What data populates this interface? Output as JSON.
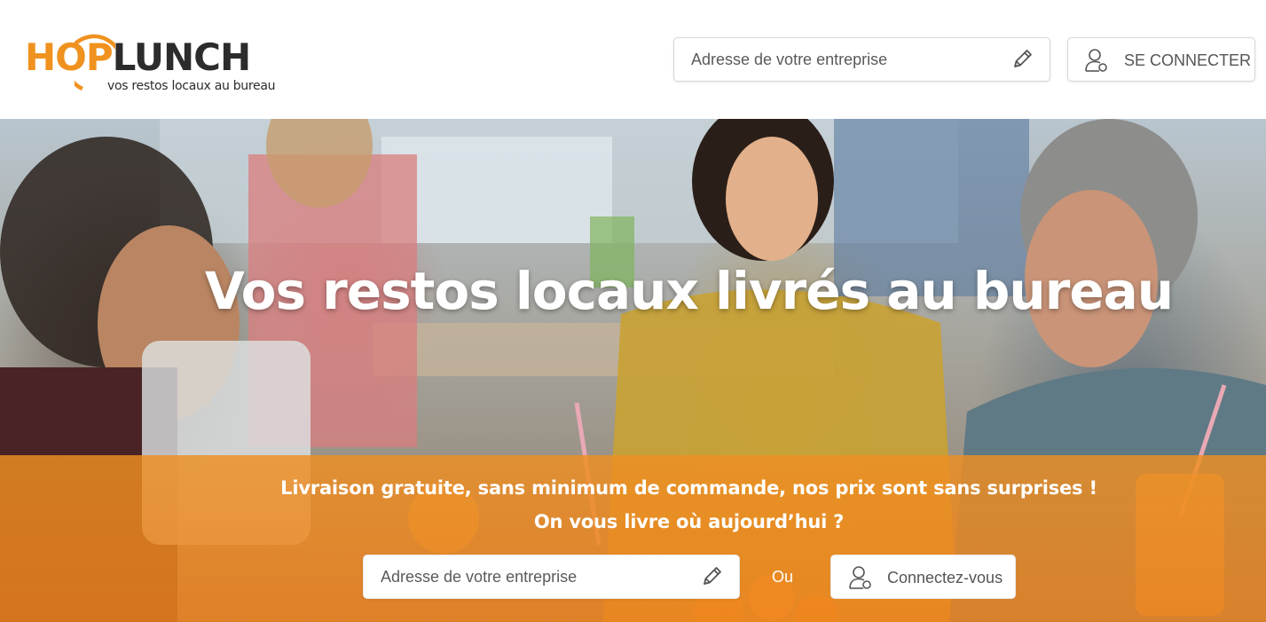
{
  "header": {
    "logo": {
      "hop": "HOP",
      "lunch": "LUNCH",
      "tagline": "vos restos locaux au bureau"
    },
    "address_input": {
      "placeholder": "Adresse de votre entreprise",
      "value": "",
      "icon": "pencil-icon"
    },
    "login_button": {
      "label": "SE CONNECTER",
      "icon": "user-icon"
    }
  },
  "hero": {
    "title": "Vos restos locaux livrés au bureau",
    "tagline_line1": "Livraison gratuite, sans minimum de commande, nos prix sont sans surprises !",
    "tagline_line2": "On vous livre où aujourd’hui ?",
    "address_input": {
      "placeholder": "Adresse de votre entreprise",
      "value": "",
      "icon": "pencil-icon"
    },
    "or_text": "Ou",
    "connect_button": {
      "label": "Connectez-vous",
      "icon": "user-icon"
    }
  },
  "colors": {
    "brand_orange": "#f0921f",
    "logo_dark": "#2c2c2c",
    "band_orange": "#ee8f22",
    "white": "#ffffff"
  }
}
